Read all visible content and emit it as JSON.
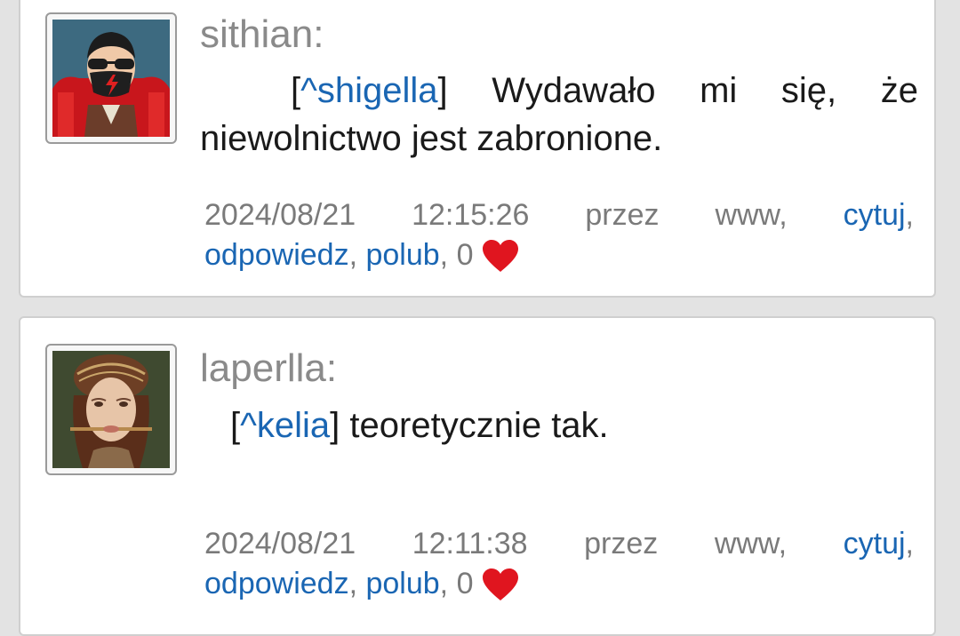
{
  "comments": [
    {
      "username": "sithian:",
      "reply_to": "^shigella",
      "message": " Wydawało mi się, że niewolnictwo jest zabronione.",
      "date": "2024/08/21",
      "time": "12:15:26",
      "via_label": "przez",
      "via": "www,",
      "quote_label": "cytuj",
      "reply_label": "odpowiedz",
      "like_label": "polub",
      "likes": "0",
      "avatar_icon": "masked-man-avatar-icon"
    },
    {
      "username": "laperlla:",
      "reply_to": "^kelia",
      "message": " teoretycznie tak.",
      "date": "2024/08/21",
      "time": "12:11:38",
      "via_label": "przez",
      "via": "www,",
      "quote_label": "cytuj",
      "reply_label": "odpowiedz",
      "like_label": "polub",
      "likes": "0",
      "avatar_icon": "renaissance-woman-avatar-icon"
    }
  ],
  "colors": {
    "link": "#1a66b3",
    "meta_text": "#7a7a7a",
    "username": "#8a8a8a",
    "heart": "#e0151f",
    "card_border": "#cfcfcf",
    "page_bg": "#e3e3e3"
  }
}
